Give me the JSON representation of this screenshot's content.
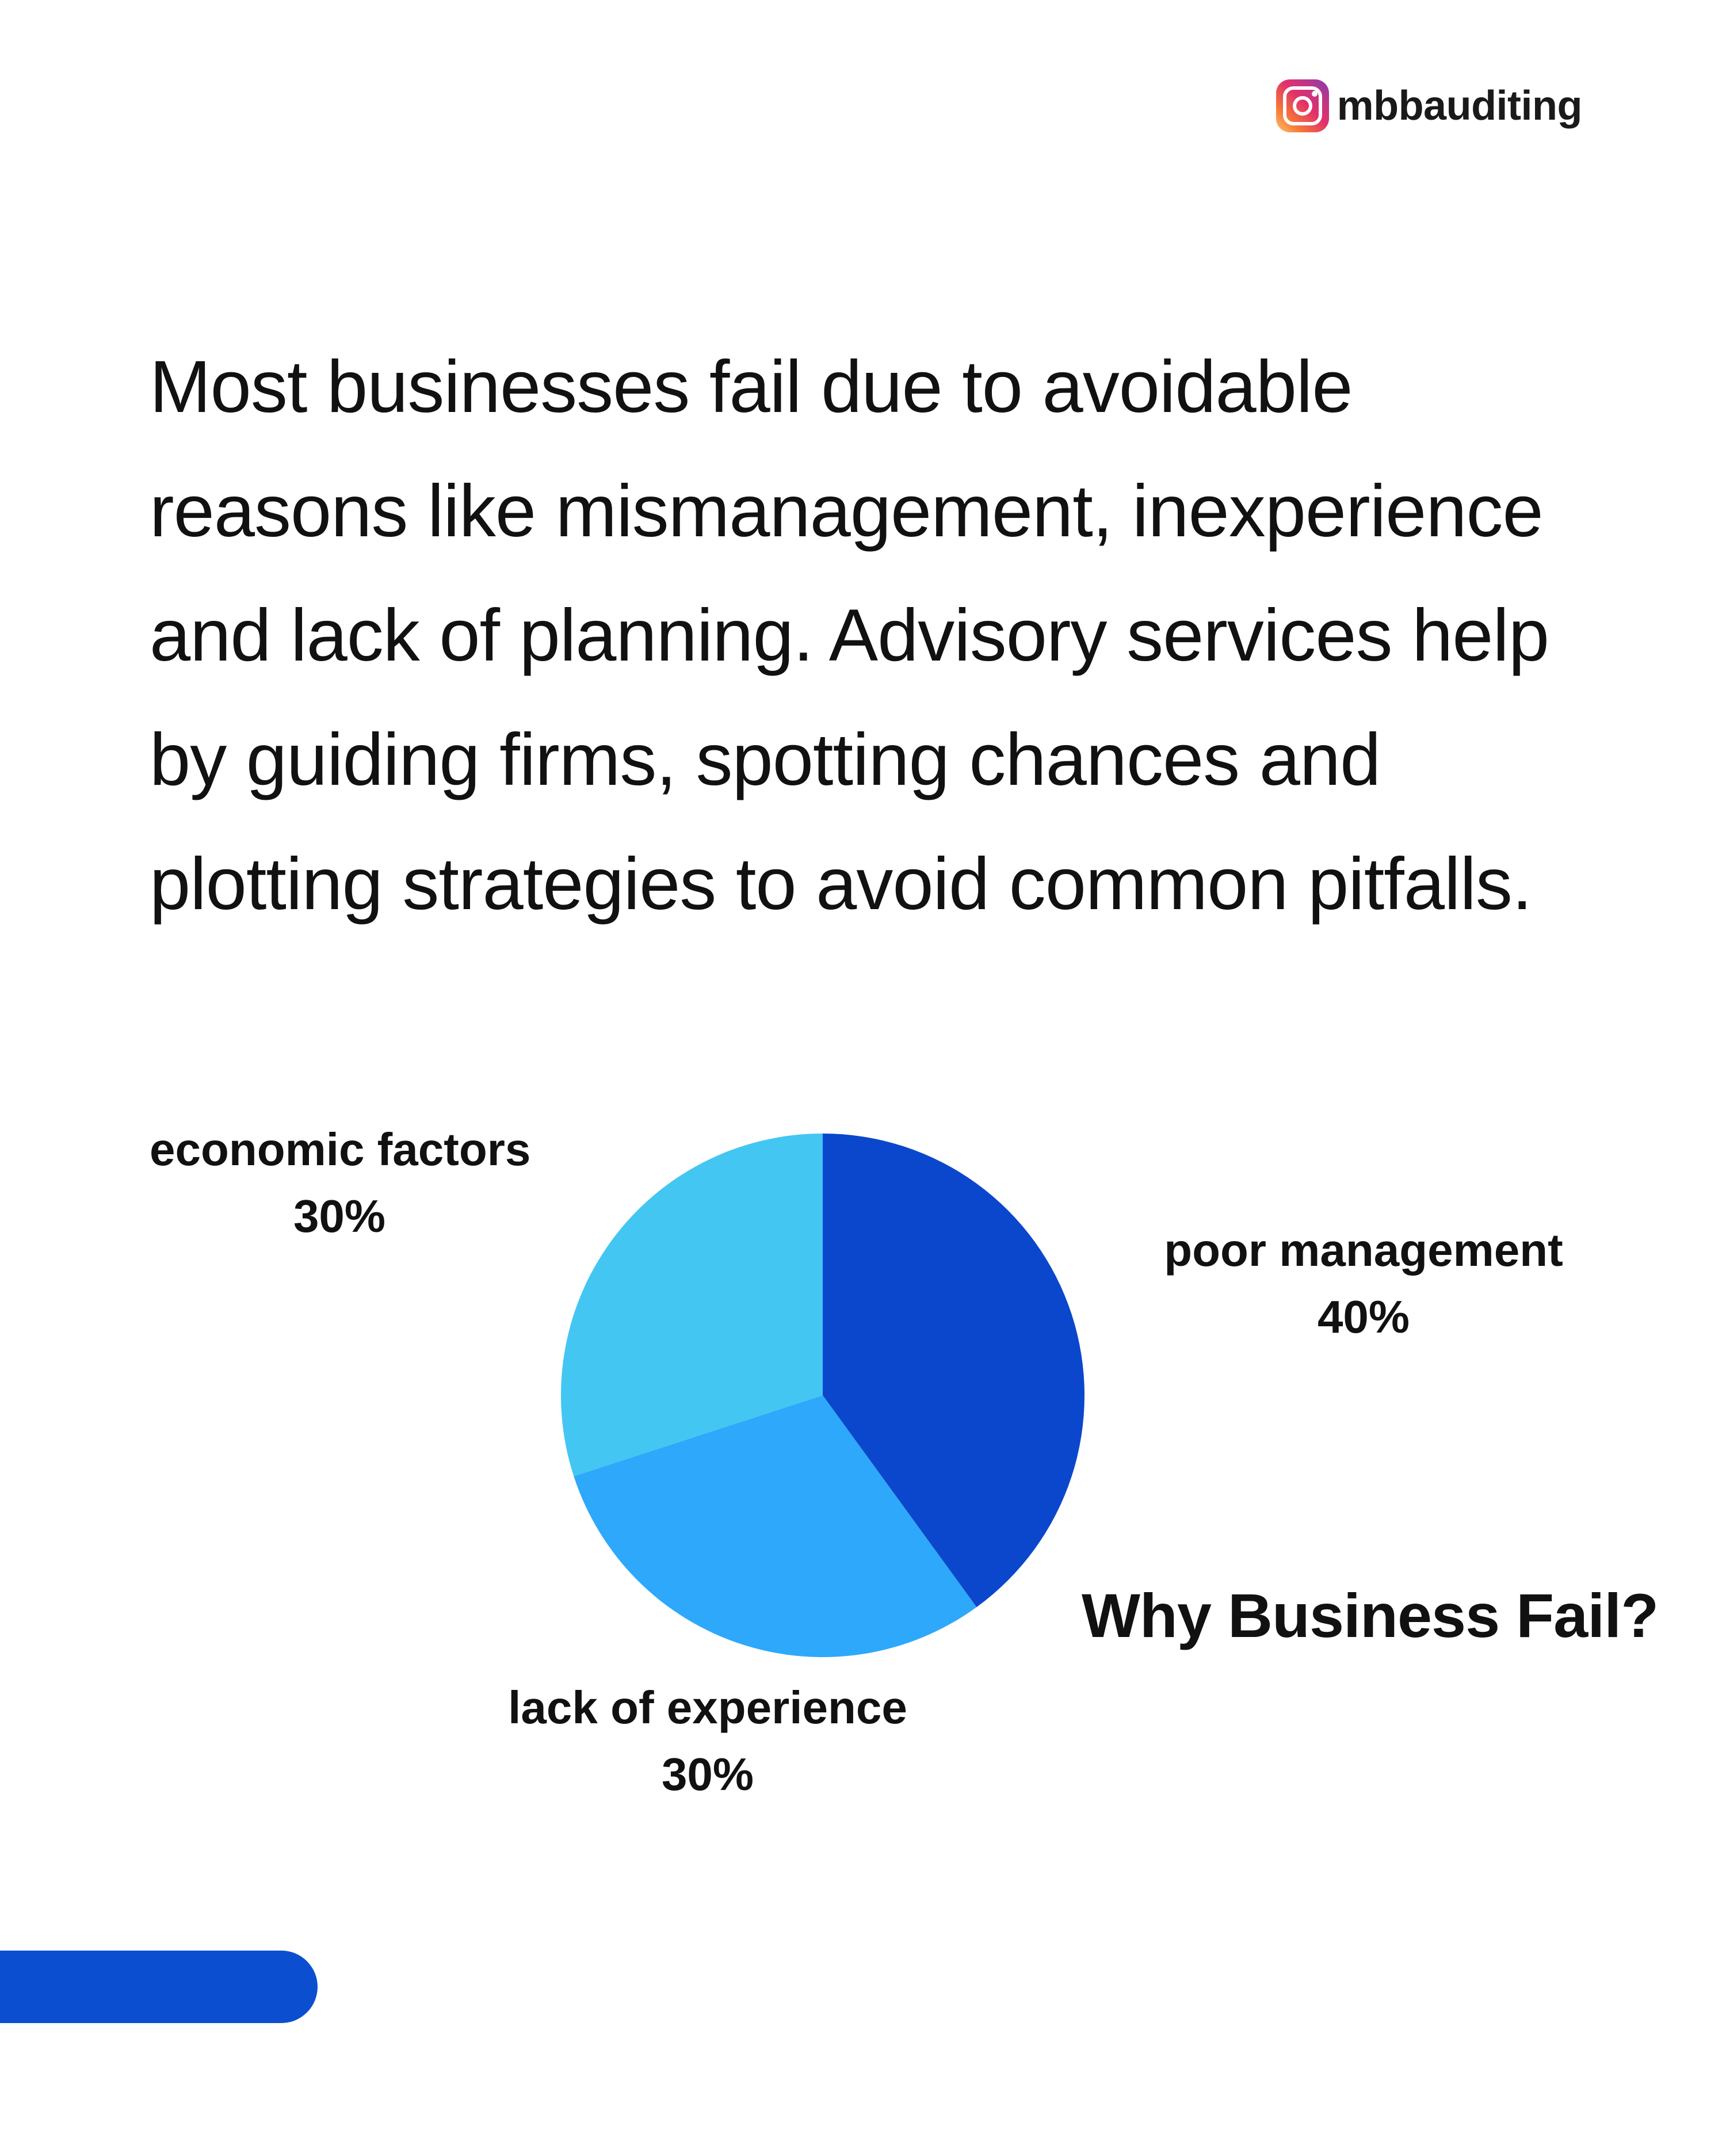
{
  "brand": {
    "handle": "mbbauditing",
    "icon": "instagram-icon"
  },
  "intro_text": "Most businesses fail due to avoidable reasons like mismanagement, inexperience and lack of planning. Advisory services help by guiding firms, spotting chances and plotting strategies to avoid common pitfalls.",
  "chart_data": {
    "type": "pie",
    "title": "Why Business Fail?",
    "categories": [
      "poor management",
      "lack of experience",
      "economic factors"
    ],
    "values": [
      40,
      30,
      30
    ],
    "value_labels": [
      "40%",
      "30%",
      "30%"
    ],
    "colors": [
      "#0a47cc",
      "#2ea8fb",
      "#43c6f2"
    ]
  },
  "colors": {
    "accent": "#0b4fd0"
  }
}
